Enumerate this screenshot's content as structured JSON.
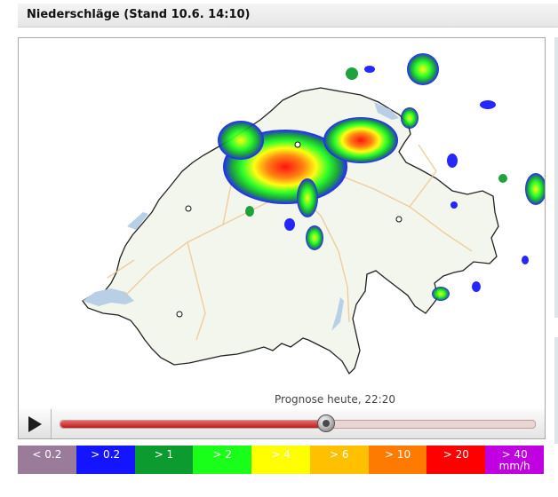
{
  "header": {
    "title": "Niederschläge (Stand 10.6. 14:10)"
  },
  "map": {
    "forecast_label": "Prognose heute, 22:20",
    "border_color": "#222222",
    "lake_color": "#b9cfe6"
  },
  "player": {
    "play_icon": "play-icon",
    "progress_percent": 56
  },
  "legend": {
    "items": [
      {
        "label": "< 0.2",
        "unit": "",
        "color": "#9a7b9a"
      },
      {
        "label": "> 0.2",
        "unit": "",
        "color": "#1414ff"
      },
      {
        "label": "> 1",
        "unit": "",
        "color": "#0b9b2e"
      },
      {
        "label": "> 2",
        "unit": "",
        "color": "#1aff1a"
      },
      {
        "label": "> 4",
        "unit": "",
        "color": "#ffff00"
      },
      {
        "label": "> 6",
        "unit": "",
        "color": "#ffc000"
      },
      {
        "label": "> 10",
        "unit": "",
        "color": "#ff7a00"
      },
      {
        "label": "> 20",
        "unit": "",
        "color": "#ff0000"
      },
      {
        "label": "> 40",
        "unit": "mm/h",
        "color": "#c000e0"
      }
    ]
  }
}
